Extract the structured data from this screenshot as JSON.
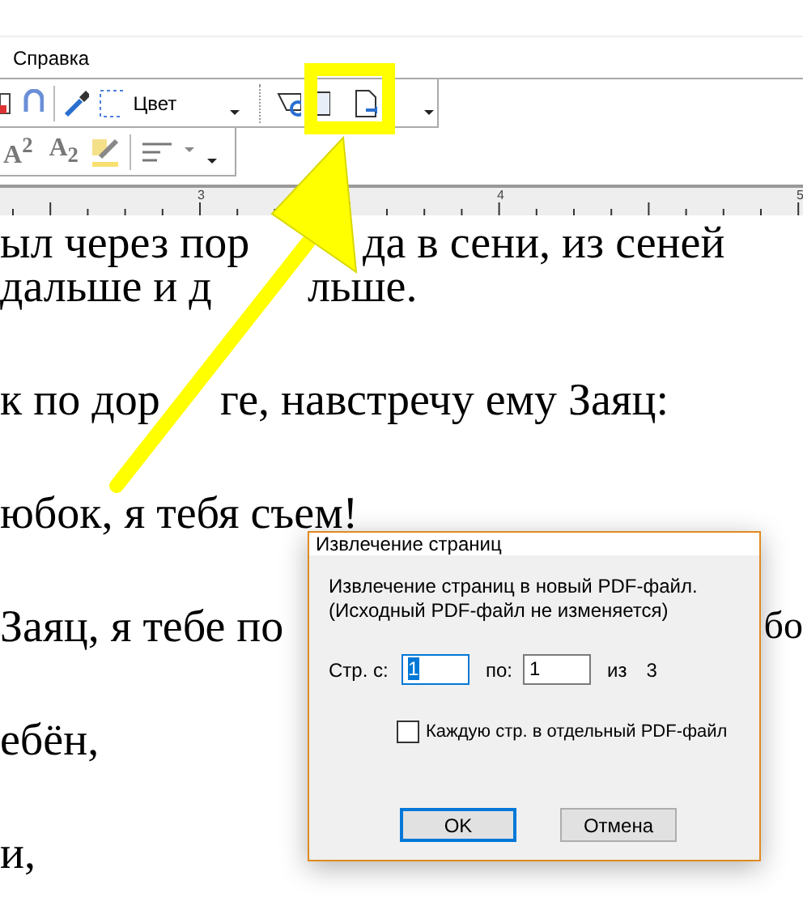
{
  "menu": [
    {
      "label": "Справка"
    }
  ],
  "toolbar_row_1": {
    "color_label": "Цвет"
  },
  "toolbar_row_2": {
    "buttons": [
      "A$^{2}$",
      "A$_{2}$"
    ]
  },
  "ruler": {
    "ticks": [
      "3",
      "4",
      "5"
    ]
  },
  "document": {
    "paragraphs": [
      {
        "lines": [
          {
            "segments": [
              "ыл через пор",
              "да в сени, из сеней"
            ]
          },
          {
            "segments": [
              "дальше и д",
              "льше."
            ]
          }
        ]
      },
      {
        "lines": [
          {
            "segments": [
              "к по дор",
              "ге, навстречу ему Заяц:"
            ]
          }
        ]
      },
      {
        "lines": [
          {
            "segments": [
              "юбок, я тебя съем!"
            ]
          }
        ]
      },
      {
        "lines": [
          {
            "segments": [
              "Заяц, я тебе по",
              "бо"
            ]
          }
        ]
      },
      {
        "lines": [
          {
            "segments": [
              "ебён,"
            ]
          }
        ]
      },
      {
        "lines": [
          {
            "segments": [
              "и,"
            ]
          }
        ]
      }
    ]
  },
  "dialog": {
    "title": "Извлечение страниц",
    "description": [
      "Извлечение страниц в новый PDF-файл.",
      "(Исходный PDF-файл не изменяется)"
    ],
    "from_label": "Стр. с:",
    "from_value": "1",
    "to_label": "по:",
    "to_value": "1",
    "of_label": "из",
    "total": "3",
    "checkbox": {
      "label": "Каждую стр. в отдельный PDF-файл",
      "checked": false
    },
    "buttons": [
      {
        "label": "OK",
        "focused": true
      },
      {
        "label": "Отмена",
        "focused": false
      }
    ]
  }
}
